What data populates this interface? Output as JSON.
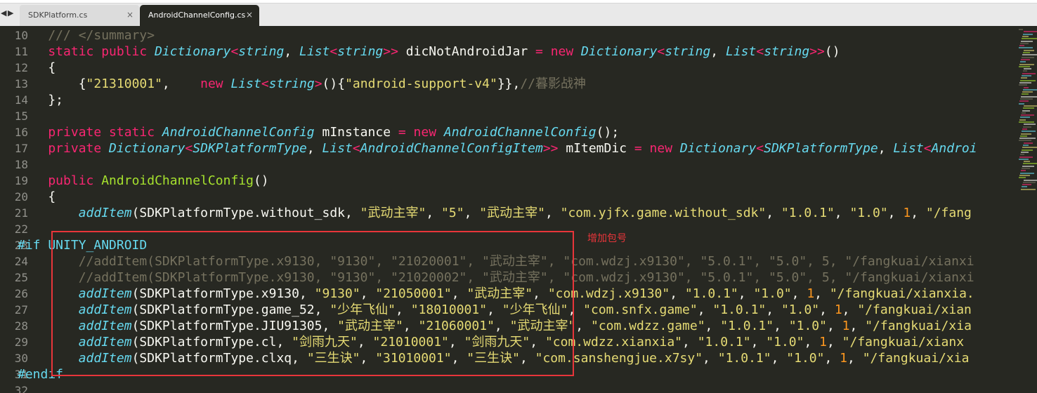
{
  "tabs": [
    {
      "label": "SDKPlatform.cs",
      "close": "×",
      "active": false
    },
    {
      "label": "AndroidChannelConfig.cs",
      "close": "×",
      "active": true
    }
  ],
  "nav": {
    "left": "◀",
    "right": "▶"
  },
  "annotation": "增加包号",
  "colors": {
    "background": "#272822",
    "keyword": "#f92672",
    "type": "#66d9ef",
    "function": "#a6e22e",
    "string": "#e6db74",
    "number": "#fd971f",
    "comment": "#75715e",
    "highlight": "#e8353a"
  },
  "code_lines": [
    {
      "num": "10",
      "tokens": [
        {
          "c": "cm",
          "t": "    /// </summary>"
        }
      ]
    },
    {
      "num": "11",
      "tokens": [
        {
          "c": "kw",
          "t": "    static public "
        },
        {
          "c": "ty",
          "t": "Dictionary"
        },
        {
          "c": "kw",
          "t": "<"
        },
        {
          "c": "ty",
          "t": "string"
        },
        {
          "c": "tx",
          "t": ", "
        },
        {
          "c": "ty",
          "t": "List"
        },
        {
          "c": "kw",
          "t": "<"
        },
        {
          "c": "ty",
          "t": "string"
        },
        {
          "c": "kw",
          "t": ">>"
        },
        {
          "c": "tx",
          "t": " dicNotAndroidJar "
        },
        {
          "c": "kw",
          "t": "="
        },
        {
          "c": "kw",
          "t": " new "
        },
        {
          "c": "ty",
          "t": "Dictionary"
        },
        {
          "c": "kw",
          "t": "<"
        },
        {
          "c": "ty",
          "t": "string"
        },
        {
          "c": "tx",
          "t": ", "
        },
        {
          "c": "ty",
          "t": "List"
        },
        {
          "c": "kw",
          "t": "<"
        },
        {
          "c": "ty",
          "t": "string"
        },
        {
          "c": "kw",
          "t": ">>"
        },
        {
          "c": "tx",
          "t": "()"
        }
      ]
    },
    {
      "num": "12",
      "tokens": [
        {
          "c": "tx",
          "t": "    {"
        }
      ]
    },
    {
      "num": "13",
      "tokens": [
        {
          "c": "tx",
          "t": "        {"
        },
        {
          "c": "st",
          "t": "\"21310001\""
        },
        {
          "c": "tx",
          "t": ",    "
        },
        {
          "c": "kw",
          "t": "new "
        },
        {
          "c": "ty",
          "t": "List"
        },
        {
          "c": "kw",
          "t": "<"
        },
        {
          "c": "ty",
          "t": "string"
        },
        {
          "c": "kw",
          "t": ">"
        },
        {
          "c": "tx",
          "t": "(){"
        },
        {
          "c": "st",
          "t": "\"android-support-v4\""
        },
        {
          "c": "tx",
          "t": "}},"
        },
        {
          "c": "cm",
          "t": "//暮影战神"
        }
      ]
    },
    {
      "num": "14",
      "tokens": [
        {
          "c": "tx",
          "t": "    };"
        }
      ]
    },
    {
      "num": "15",
      "tokens": []
    },
    {
      "num": "16",
      "tokens": [
        {
          "c": "kw",
          "t": "    private static "
        },
        {
          "c": "ty",
          "t": "AndroidChannelConfig"
        },
        {
          "c": "tx",
          "t": " mInstance "
        },
        {
          "c": "kw",
          "t": "="
        },
        {
          "c": "kw",
          "t": " new "
        },
        {
          "c": "ty",
          "t": "AndroidChannelConfig"
        },
        {
          "c": "tx",
          "t": "();"
        }
      ]
    },
    {
      "num": "17",
      "tokens": [
        {
          "c": "kw",
          "t": "    private "
        },
        {
          "c": "ty",
          "t": "Dictionary"
        },
        {
          "c": "kw",
          "t": "<"
        },
        {
          "c": "ty",
          "t": "SDKPlatformType"
        },
        {
          "c": "tx",
          "t": ", "
        },
        {
          "c": "ty",
          "t": "List"
        },
        {
          "c": "kw",
          "t": "<"
        },
        {
          "c": "ty",
          "t": "AndroidChannelConfigItem"
        },
        {
          "c": "kw",
          "t": ">>"
        },
        {
          "c": "tx",
          "t": " mItemDic "
        },
        {
          "c": "kw",
          "t": "="
        },
        {
          "c": "kw",
          "t": " new "
        },
        {
          "c": "ty",
          "t": "Dictionary"
        },
        {
          "c": "kw",
          "t": "<"
        },
        {
          "c": "ty",
          "t": "SDKPlatformType"
        },
        {
          "c": "tx",
          "t": ", "
        },
        {
          "c": "ty",
          "t": "List"
        },
        {
          "c": "kw",
          "t": "<"
        },
        {
          "c": "ty",
          "t": "Androi"
        }
      ]
    },
    {
      "num": "18",
      "tokens": []
    },
    {
      "num": "19",
      "tokens": [
        {
          "c": "kw",
          "t": "    public "
        },
        {
          "c": "fn",
          "t": "AndroidChannelConfig"
        },
        {
          "c": "tx",
          "t": "()"
        }
      ]
    },
    {
      "num": "20",
      "tokens": [
        {
          "c": "tx",
          "t": "    {"
        }
      ]
    },
    {
      "num": "21",
      "tokens": [
        {
          "c": "ty",
          "t": "        addItem"
        },
        {
          "c": "tx",
          "t": "(SDKPlatformType.without_sdk, "
        },
        {
          "c": "st",
          "t": "\"武动主宰\""
        },
        {
          "c": "tx",
          "t": ", "
        },
        {
          "c": "st",
          "t": "\"5\""
        },
        {
          "c": "tx",
          "t": ", "
        },
        {
          "c": "st",
          "t": "\"武动主宰\""
        },
        {
          "c": "tx",
          "t": ", "
        },
        {
          "c": "st",
          "t": "\"com.yjfx.game.without_sdk\""
        },
        {
          "c": "tx",
          "t": ", "
        },
        {
          "c": "st",
          "t": "\"1.0.1\""
        },
        {
          "c": "tx",
          "t": ", "
        },
        {
          "c": "st",
          "t": "\"1.0\""
        },
        {
          "c": "tx",
          "t": ", "
        },
        {
          "c": "nu",
          "t": "1"
        },
        {
          "c": "tx",
          "t": ", "
        },
        {
          "c": "st",
          "t": "\"/fang"
        }
      ]
    },
    {
      "num": "22",
      "tokens": []
    },
    {
      "num": "23",
      "tokens": [
        {
          "c": "pp",
          "t": "#if UNITY_ANDROID"
        }
      ]
    },
    {
      "num": "24",
      "tokens": [
        {
          "c": "cm",
          "t": "        //addItem(SDKPlatformType.x9130, \"9130\", \"21020001\", \"武动主宰\", \"com.wdzj.x9130\", \"5.0.1\", \"5.0\", 5, \"/fangkuai/xianxi"
        }
      ]
    },
    {
      "num": "25",
      "tokens": [
        {
          "c": "cm",
          "t": "        //addItem(SDKPlatformType.x9130, \"9130\", \"21020002\", \"武动主宰\", \"com.wdzj.x9130\", \"5.0.1\", \"5.0\", 5, \"/fangkuai/xianxi"
        }
      ]
    },
    {
      "num": "26",
      "tokens": [
        {
          "c": "ty",
          "t": "        addItem"
        },
        {
          "c": "tx",
          "t": "(SDKPlatformType.x9130, "
        },
        {
          "c": "st",
          "t": "\"9130\""
        },
        {
          "c": "tx",
          "t": ", "
        },
        {
          "c": "st",
          "t": "\"21050001\""
        },
        {
          "c": "tx",
          "t": ", "
        },
        {
          "c": "st",
          "t": "\"武动主宰\""
        },
        {
          "c": "tx",
          "t": ", "
        },
        {
          "c": "st",
          "t": "\"com.wdzj.x9130\""
        },
        {
          "c": "tx",
          "t": ", "
        },
        {
          "c": "st",
          "t": "\"1.0.1\""
        },
        {
          "c": "tx",
          "t": ", "
        },
        {
          "c": "st",
          "t": "\"1.0\""
        },
        {
          "c": "tx",
          "t": ", "
        },
        {
          "c": "nu",
          "t": "1"
        },
        {
          "c": "tx",
          "t": ", "
        },
        {
          "c": "st",
          "t": "\"/fangkuai/xianxia."
        }
      ]
    },
    {
      "num": "27",
      "tokens": [
        {
          "c": "ty",
          "t": "        addItem"
        },
        {
          "c": "tx",
          "t": "(SDKPlatformType.game_52, "
        },
        {
          "c": "st",
          "t": "\"少年飞仙\""
        },
        {
          "c": "tx",
          "t": ", "
        },
        {
          "c": "st",
          "t": "\"18010001\""
        },
        {
          "c": "tx",
          "t": ", "
        },
        {
          "c": "st",
          "t": "\"少年飞仙\""
        },
        {
          "c": "tx",
          "t": ", "
        },
        {
          "c": "st",
          "t": "\"com.snfx.game\""
        },
        {
          "c": "tx",
          "t": ", "
        },
        {
          "c": "st",
          "t": "\"1.0.1\""
        },
        {
          "c": "tx",
          "t": ", "
        },
        {
          "c": "st",
          "t": "\"1.0\""
        },
        {
          "c": "tx",
          "t": ", "
        },
        {
          "c": "nu",
          "t": "1"
        },
        {
          "c": "tx",
          "t": ", "
        },
        {
          "c": "st",
          "t": "\"/fangkuai/xian"
        }
      ]
    },
    {
      "num": "28",
      "tokens": [
        {
          "c": "ty",
          "t": "        addItem"
        },
        {
          "c": "tx",
          "t": "(SDKPlatformType.JIU91305, "
        },
        {
          "c": "st",
          "t": "\"武动主宰\""
        },
        {
          "c": "tx",
          "t": ", "
        },
        {
          "c": "st",
          "t": "\"21060001\""
        },
        {
          "c": "tx",
          "t": ", "
        },
        {
          "c": "st",
          "t": "\"武动主宰\""
        },
        {
          "c": "tx",
          "t": ", "
        },
        {
          "c": "st",
          "t": "\"com.wdzz.game\""
        },
        {
          "c": "tx",
          "t": ", "
        },
        {
          "c": "st",
          "t": "\"1.0.1\""
        },
        {
          "c": "tx",
          "t": ", "
        },
        {
          "c": "st",
          "t": "\"1.0\""
        },
        {
          "c": "tx",
          "t": ", "
        },
        {
          "c": "nu",
          "t": "1"
        },
        {
          "c": "tx",
          "t": ", "
        },
        {
          "c": "st",
          "t": "\"/fangkuai/xia"
        }
      ]
    },
    {
      "num": "29",
      "tokens": [
        {
          "c": "ty",
          "t": "        addItem"
        },
        {
          "c": "tx",
          "t": "(SDKPlatformType.cl, "
        },
        {
          "c": "st",
          "t": "\"剑雨九天\""
        },
        {
          "c": "tx",
          "t": ", "
        },
        {
          "c": "st",
          "t": "\"21010001\""
        },
        {
          "c": "tx",
          "t": ", "
        },
        {
          "c": "st",
          "t": "\"剑雨九天\""
        },
        {
          "c": "tx",
          "t": ", "
        },
        {
          "c": "st",
          "t": "\"com.wdzz.xianxia\""
        },
        {
          "c": "tx",
          "t": ", "
        },
        {
          "c": "st",
          "t": "\"1.0.1\""
        },
        {
          "c": "tx",
          "t": ", "
        },
        {
          "c": "st",
          "t": "\"1.0\""
        },
        {
          "c": "tx",
          "t": ", "
        },
        {
          "c": "nu",
          "t": "1"
        },
        {
          "c": "tx",
          "t": ", "
        },
        {
          "c": "st",
          "t": "\"/fangkuai/xianx"
        }
      ]
    },
    {
      "num": "30",
      "tokens": [
        {
          "c": "ty",
          "t": "        addItem"
        },
        {
          "c": "tx",
          "t": "(SDKPlatformType.clxq, "
        },
        {
          "c": "st",
          "t": "\"三生诀\""
        },
        {
          "c": "tx",
          "t": ", "
        },
        {
          "c": "st",
          "t": "\"31010001\""
        },
        {
          "c": "tx",
          "t": ", "
        },
        {
          "c": "st",
          "t": "\"三生诀\""
        },
        {
          "c": "tx",
          "t": ", "
        },
        {
          "c": "st",
          "t": "\"com.sanshengjue.x7sy\""
        },
        {
          "c": "tx",
          "t": ", "
        },
        {
          "c": "st",
          "t": "\"1.0.1\""
        },
        {
          "c": "tx",
          "t": ", "
        },
        {
          "c": "st",
          "t": "\"1.0\""
        },
        {
          "c": "tx",
          "t": ", "
        },
        {
          "c": "nu",
          "t": "1"
        },
        {
          "c": "tx",
          "t": ", "
        },
        {
          "c": "st",
          "t": "\"/fangkuai/xia"
        }
      ]
    },
    {
      "num": "31",
      "tokens": [
        {
          "c": "pp",
          "t": "#endif"
        }
      ]
    },
    {
      "num": "32",
      "tokens": []
    }
  ]
}
